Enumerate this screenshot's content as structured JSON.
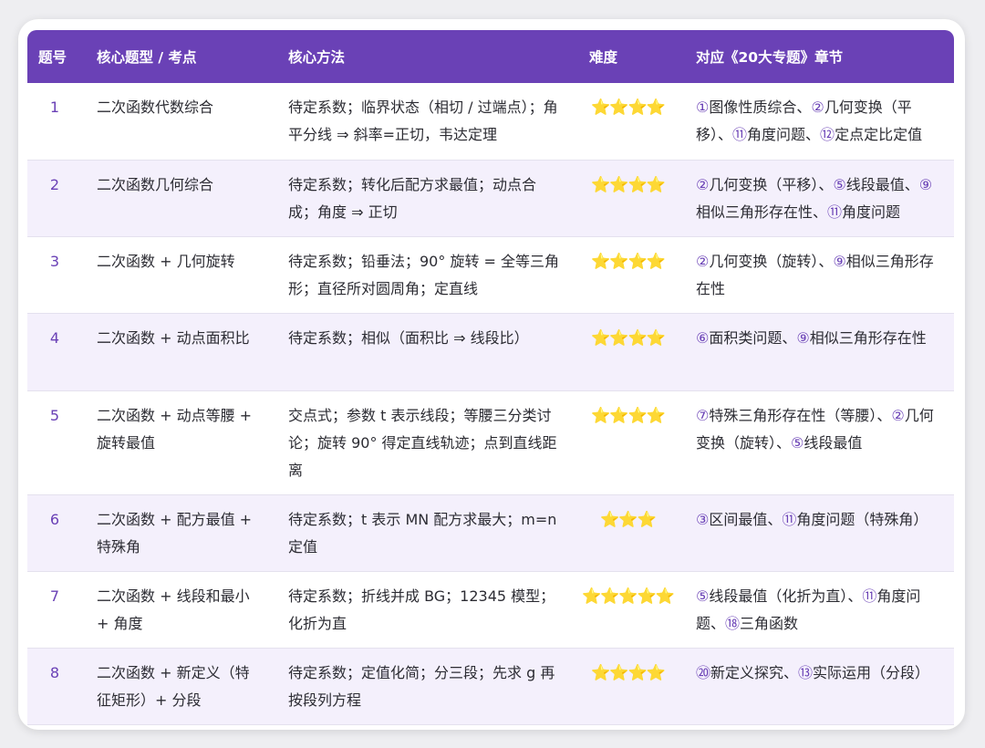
{
  "headers": {
    "num": "题号",
    "type": "核心题型 / 考点",
    "method": "核心方法",
    "difficulty": "难度",
    "chapters": "对应《20大专题》章节"
  },
  "rows": [
    {
      "num": "1",
      "type": "二次函数代数综合",
      "method": "待定系数；临界状态（相切 / 过端点）；角平分线 ⇒ 斜率=正切，韦达定理",
      "stars": "⭐⭐⭐⭐",
      "chapters": [
        {
          "mark": "①",
          "text": "图像性质综合、"
        },
        {
          "mark": "②",
          "text": "几何变换（平移）、"
        },
        {
          "mark": "⑪",
          "text": "角度问题、"
        },
        {
          "mark": "⑫",
          "text": "定点定比定值"
        }
      ]
    },
    {
      "num": "2",
      "type": "二次函数几何综合",
      "method": "待定系数；转化后配方求最值；动点合成；角度 ⇒ 正切",
      "stars": "⭐⭐⭐⭐",
      "chapters": [
        {
          "mark": "②",
          "text": "几何变换（平移）、"
        },
        {
          "mark": "⑤",
          "text": "线段最值、"
        },
        {
          "mark": "⑨",
          "text": "相似三角形存在性、"
        },
        {
          "mark": "⑪",
          "text": "角度问题"
        }
      ]
    },
    {
      "num": "3",
      "type": "二次函数 + 几何旋转",
      "method": "待定系数；铅垂法；90° 旋转 = 全等三角形；直径所对圆周角；定直线",
      "stars": "⭐⭐⭐⭐",
      "chapters": [
        {
          "mark": "②",
          "text": "几何变换（旋转）、"
        },
        {
          "mark": "⑨",
          "text": "相似三角形存在性"
        }
      ]
    },
    {
      "num": "4",
      "type": "二次函数 + 动点面积比",
      "method": "待定系数；相似（面积比 ⇒ 线段比）",
      "stars": "⭐⭐⭐⭐",
      "chapters": [
        {
          "mark": "⑥",
          "text": "面积类问题、"
        },
        {
          "mark": "⑨",
          "text": "相似三角形存在性"
        }
      ]
    },
    {
      "num": "5",
      "type": "二次函数 + 动点等腰 + 旋转最值",
      "method": "交点式；参数 t 表示线段；等腰三分类讨论；旋转 90° 得定直线轨迹；点到直线距离",
      "stars": "⭐⭐⭐⭐",
      "chapters": [
        {
          "mark": "⑦",
          "text": "特殊三角形存在性（等腰）、"
        },
        {
          "mark": "②",
          "text": "几何变换（旋转）、"
        },
        {
          "mark": "⑤",
          "text": "线段最值"
        }
      ]
    },
    {
      "num": "6",
      "type": "二次函数 + 配方最值 + 特殊角",
      "method": "待定系数；t 表示 MN 配方求最大；m=n 定值",
      "stars": "⭐⭐⭐",
      "chapters": [
        {
          "mark": "③",
          "text": "区间最值、"
        },
        {
          "mark": "⑪",
          "text": "角度问题（特殊角）"
        }
      ]
    },
    {
      "num": "7",
      "type": "二次函数 + 线段和最小 + 角度",
      "method": "待定系数；折线并成 BG；12345 模型；化折为直",
      "stars": "⭐⭐⭐⭐⭐",
      "chapters": [
        {
          "mark": "⑤",
          "text": "线段最值（化折为直）、"
        },
        {
          "mark": "⑪",
          "text": "角度问题、"
        },
        {
          "mark": "⑱",
          "text": "三角函数"
        }
      ]
    },
    {
      "num": "8",
      "type": "二次函数 + 新定义（特征矩形）+ 分段",
      "method": "待定系数；定值化简；分三段；先求 g 再按段列方程",
      "stars": "⭐⭐⭐⭐",
      "chapters": [
        {
          "mark": "⑳",
          "text": "新定义探究、"
        },
        {
          "mark": "⑬",
          "text": "实际运用（分段）"
        }
      ]
    }
  ]
}
